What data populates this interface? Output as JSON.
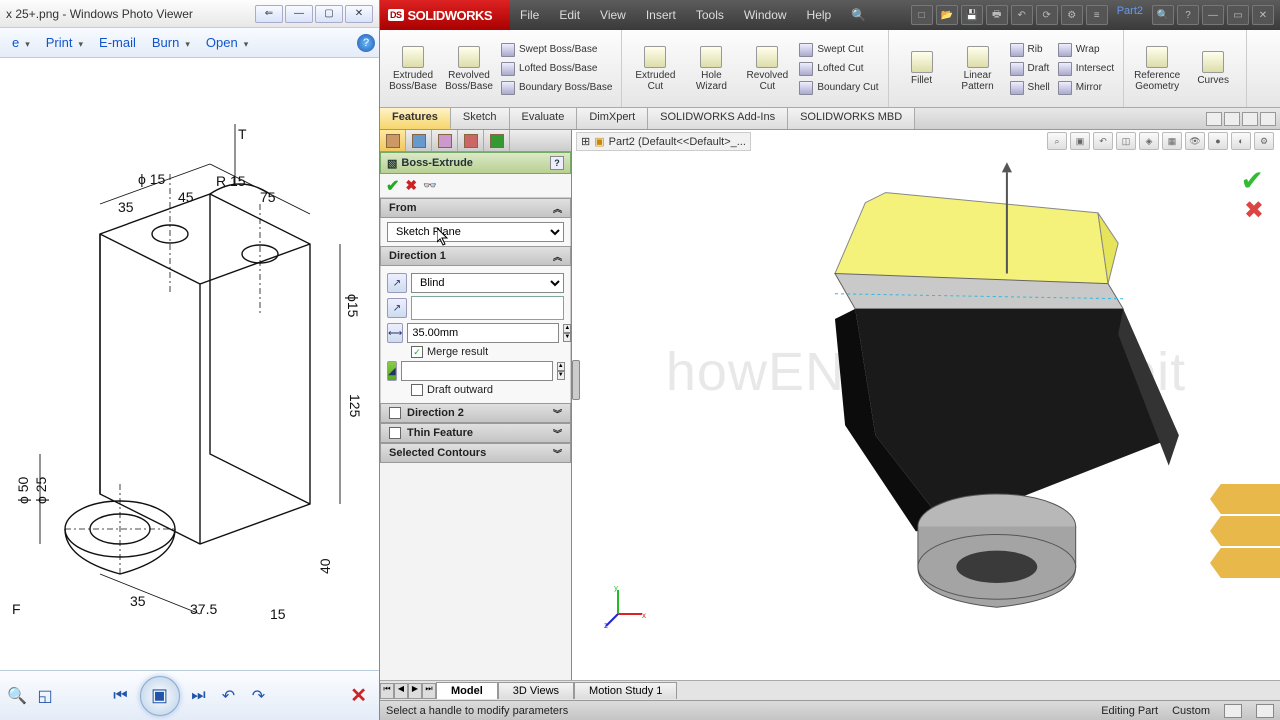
{
  "wpv": {
    "title": "x 25+.png - Windows Photo Viewer",
    "toolbar": {
      "file": "e",
      "print": "Print",
      "email": "E-mail",
      "burn": "Burn",
      "open": "Open"
    }
  },
  "sw": {
    "logo": "SOLIDWORKS",
    "menu": [
      "File",
      "Edit",
      "View",
      "Insert",
      "Tools",
      "Window",
      "Help"
    ],
    "doc_crumb": "Part2",
    "ribbon": {
      "extruded": "Extruded Boss/Base",
      "revolved": "Revolved Boss/Base",
      "swept": "Swept Boss/Base",
      "lofted": "Lofted Boss/Base",
      "boundary": "Boundary Boss/Base",
      "extcut": "Extruded Cut",
      "hole": "Hole Wizard",
      "revcut": "Revolved Cut",
      "sweptcut": "Swept Cut",
      "loftcut": "Lofted Cut",
      "boundcut": "Boundary Cut",
      "fillet": "Fillet",
      "linpat": "Linear Pattern",
      "rib": "Rib",
      "draft": "Draft",
      "shell": "Shell",
      "wrap": "Wrap",
      "intersect": "Intersect",
      "mirror": "Mirror",
      "refgeo": "Reference Geometry",
      "curves": "Curves"
    },
    "tabs": [
      "Features",
      "Sketch",
      "Evaluate",
      "DimXpert",
      "SOLIDWORKS Add-Ins",
      "SOLIDWORKS MBD"
    ],
    "pm": {
      "title": "Boss-Extrude",
      "from_label": "From",
      "from_value": "Sketch Plane",
      "dir1_label": "Direction 1",
      "dir1_type": "Blind",
      "depth": "35.00mm",
      "merge": "Merge result",
      "draft_out": "Draft outward",
      "dir2_label": "Direction 2",
      "thin_label": "Thin Feature",
      "selcon_label": "Selected Contours"
    },
    "crumb": "Part2  (Default<<Default>_...",
    "watermark": "howENGINEERSdoit",
    "btabs": [
      "Model",
      "3D Views",
      "Motion Study 1"
    ],
    "status_msg": "Select a handle to modify parameters",
    "status_mode": "Editing Part",
    "status_custom": "Custom"
  }
}
